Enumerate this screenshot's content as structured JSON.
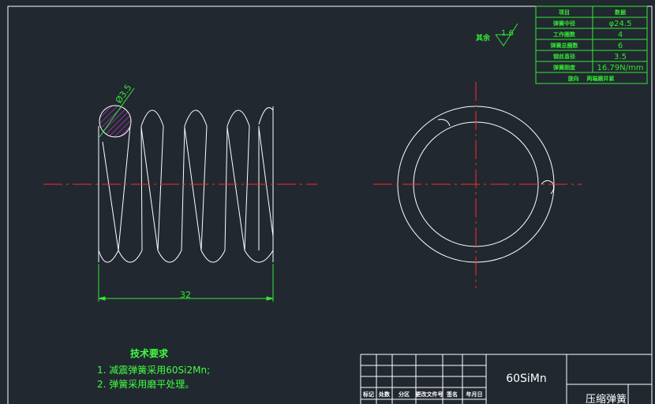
{
  "spec_table": {
    "header": [
      "项目",
      "数据"
    ],
    "rows": [
      {
        "label": "弹簧中径",
        "value": "φ24.5"
      },
      {
        "label": "工作圈数",
        "value": "4"
      },
      {
        "label": "弹簧总圈数",
        "value": "6"
      },
      {
        "label": "钢丝直径",
        "value": "3.5"
      },
      {
        "label": "弹簧刚度",
        "value": "16.79N/mm"
      }
    ],
    "footer": "旋向    两端磨并紧"
  },
  "surface_roughness": {
    "prefix": "其余",
    "value": "1.6"
  },
  "dimensions": {
    "wire_diameter": "Ø3.5",
    "free_length": "32"
  },
  "tech_requirements": {
    "title": "技术要求",
    "items": [
      "1. 减震弹簧采用60Si2Mn;",
      "2. 弹簧采用磨平处理。"
    ]
  },
  "title_block": {
    "material": "60SiMn",
    "part_name": "压缩弹簧",
    "columns": [
      "标记",
      "处数",
      "分区",
      "更改文件号",
      "签名",
      "年月日"
    ]
  },
  "colors": {
    "background": "#212830",
    "lines": "#ffffff",
    "centerline": "#ff2a2a",
    "dimension": "#33e833",
    "hatch": "#d23dd2",
    "annotation": "#40ff40"
  }
}
